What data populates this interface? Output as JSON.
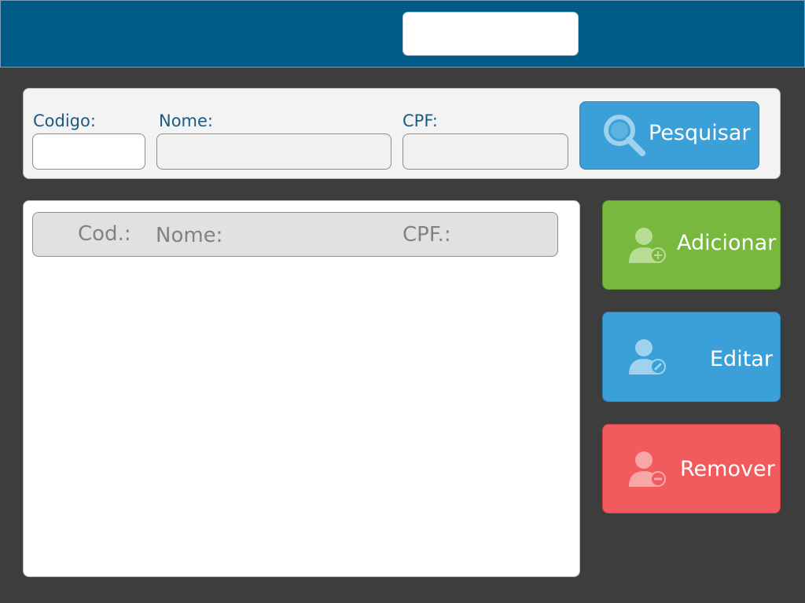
{
  "header": {
    "input_value": ""
  },
  "search": {
    "codigo_label": "Codigo:",
    "nome_label": "Nome:",
    "cpf_label": "CPF:",
    "codigo_value": "",
    "nome_value": "",
    "cpf_value": "",
    "button_label": "Pesquisar",
    "button_icon": "search-icon"
  },
  "table": {
    "columns": [
      "Cod.:",
      "Nome:",
      "CPF.:"
    ],
    "rows": []
  },
  "actions": {
    "add_label": "Adicionar",
    "add_icon": "user-add-icon",
    "edit_label": "Editar",
    "edit_icon": "user-edit-icon",
    "remove_label": "Remover",
    "remove_icon": "user-remove-icon"
  },
  "colors": {
    "header_bg": "#005b87",
    "background": "#3d3d3d",
    "label_text": "#1b5b82",
    "search_button": "#3aa0d7",
    "add_button": "#78b83f",
    "edit_button": "#3aa0d7",
    "remove_button": "#f15b5e"
  }
}
